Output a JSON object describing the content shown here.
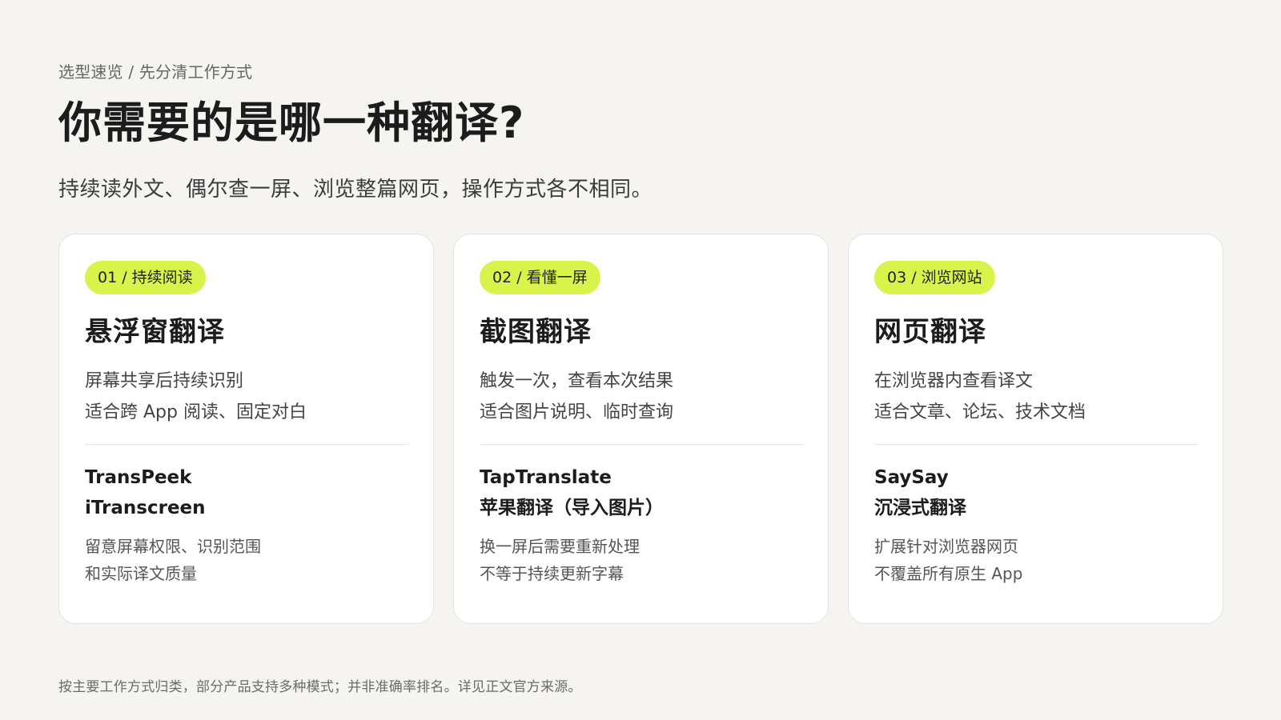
{
  "header": {
    "eyebrow": "选型速览 / 先分清工作方式",
    "title": "你需要的是哪一种翻译?",
    "subtitle": "持续读外文、偶尔查一屏、浏览整篇网页，操作方式各不相同。"
  },
  "cards": [
    {
      "tag": "01 / 持续阅读",
      "title": "悬浮窗翻译",
      "desc": [
        "屏幕共享后持续识别",
        "适合跨 App 阅读、固定对白"
      ],
      "products": [
        "TransPeek",
        "iTranscreen"
      ],
      "notes": [
        "留意屏幕权限、识别范围",
        "和实际译文质量"
      ]
    },
    {
      "tag": "02 / 看懂一屏",
      "title": "截图翻译",
      "desc": [
        "触发一次，查看本次结果",
        "适合图片说明、临时查询"
      ],
      "products": [
        "TapTranslate",
        "苹果翻译（导入图片）"
      ],
      "notes": [
        "换一屏后需要重新处理",
        "不等于持续更新字幕"
      ]
    },
    {
      "tag": "03 / 浏览网站",
      "title": "网页翻译",
      "desc": [
        "在浏览器内查看译文",
        "适合文章、论坛、技术文档"
      ],
      "products": [
        "SaySay",
        "沉浸式翻译"
      ],
      "notes": [
        "扩展针对浏览器网页",
        "不覆盖所有原生 App"
      ]
    }
  ],
  "footnote": "按主要工作方式归类，部分产品支持多种模式；并非准确率排名。详见正文官方来源。",
  "colors": {
    "background": "#f5f4f0",
    "accent": "#d9f34a",
    "card": "#ffffff"
  }
}
